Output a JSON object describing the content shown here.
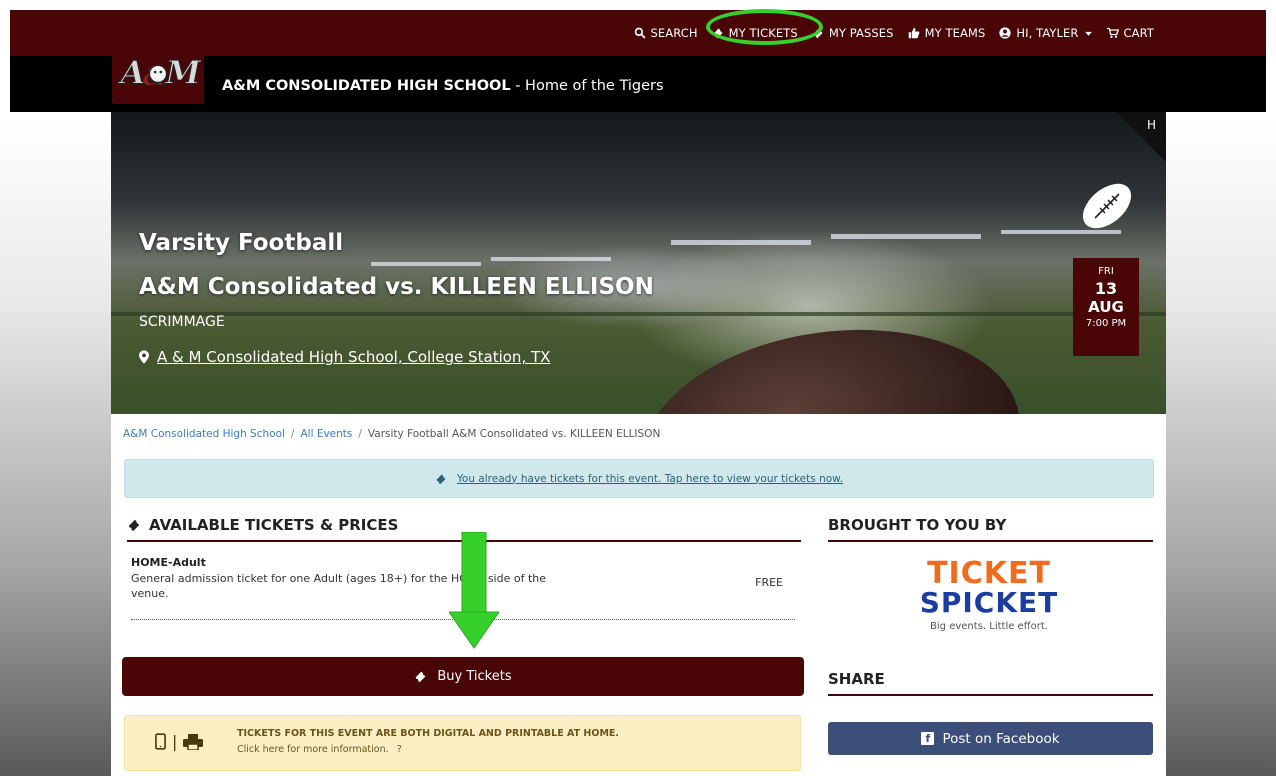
{
  "nav": {
    "search": "SEARCH",
    "my_tickets": "MY TICKETS",
    "my_passes": "MY PASSES",
    "my_teams": "MY TEAMS",
    "user": "HI, TAYLER",
    "cart": "CART"
  },
  "school": {
    "name": "A&M CONSOLIDATED HIGH SCHOOL",
    "tagline": " - Home of the Tigers"
  },
  "event": {
    "sport": "Varsity Football",
    "title": "A&M Consolidated vs. KILLEEN ELLISON",
    "type": "SCRIMMAGE",
    "location": "A & M Consolidated High School, College Station, TX",
    "corner_label": "H",
    "date": {
      "dow": "FRI",
      "day": "13",
      "month": "AUG",
      "time": "7:00 PM"
    }
  },
  "breadcrumb": {
    "home": "A&M Consolidated High School",
    "all_events": "All Events",
    "current": "Varsity Football A&M Consolidated vs. KILLEEN ELLISON"
  },
  "alert": {
    "text": "You already have tickets for this event. Tap here to view your tickets now."
  },
  "tickets": {
    "heading": "AVAILABLE TICKETS & PRICES",
    "items": [
      {
        "name": "HOME-Adult",
        "description": "General admission ticket for one Adult (ages 18+) for the HOME side of the venue.",
        "price": "FREE"
      }
    ],
    "buy_label": "Buy Tickets"
  },
  "info": {
    "title": "TICKETS FOR THIS EVENT ARE BOTH DIGITAL AND PRINTABLE AT HOME.",
    "subtitle": "Click here for more information."
  },
  "sidebar": {
    "brought_heading": "BROUGHT TO YOU BY",
    "sponsor_line1": "TICKET",
    "sponsor_line2": "SPICKET",
    "sponsor_tagline": "Big events. Little effort.",
    "share_heading": "SHARE",
    "facebook_label": "Post on Facebook"
  },
  "colors": {
    "maroon": "#4a0606",
    "highlight_green": "#35d12a",
    "alert_bg": "#cfe8ec",
    "facebook": "#3b4f7a"
  }
}
